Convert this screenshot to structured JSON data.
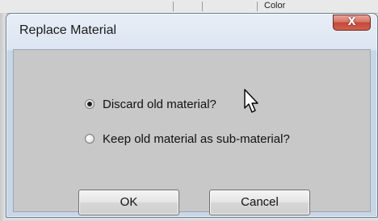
{
  "dialog": {
    "title": "Replace Material",
    "close_glyph": "X"
  },
  "options": [
    {
      "label": "Discard old material?",
      "checked": true
    },
    {
      "label": "Keep old material as sub-material?",
      "checked": false
    }
  ],
  "buttons": {
    "ok": "OK",
    "cancel": "Cancel"
  },
  "background": {
    "partial_text": "Color"
  },
  "icons": {
    "close": "close-icon",
    "cursor": "mouse-pointer-icon"
  },
  "colors": {
    "close_button": "#c4493b",
    "client_bg": "#c8c8c8",
    "titlebar": "#dbe5f1"
  }
}
